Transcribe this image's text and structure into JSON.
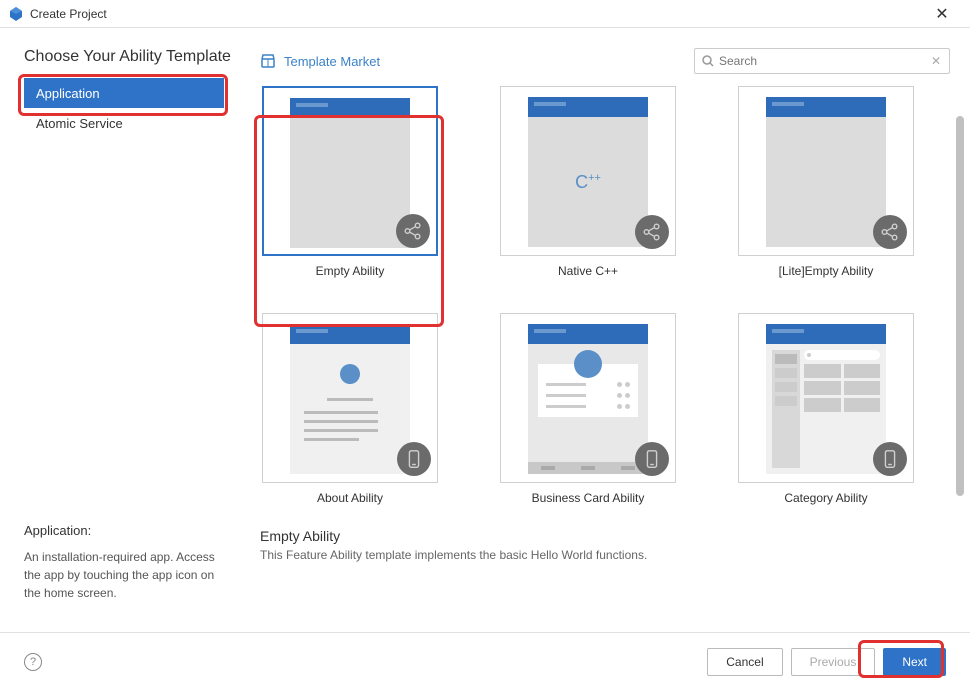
{
  "window": {
    "title": "Create Project"
  },
  "sidebar": {
    "heading": "Choose Your Ability Template",
    "items": [
      "Application",
      "Atomic Service"
    ],
    "selected_index": 0,
    "desc_title": "Application:",
    "desc_text": "An installation-required app. Access the app by touching the app icon on the home screen."
  },
  "main": {
    "market_label": "Template Market",
    "search_placeholder": "Search",
    "templates": [
      {
        "name": "Empty Ability",
        "selected": true,
        "icon": "share",
        "content": "blank"
      },
      {
        "name": "Native C++",
        "selected": false,
        "icon": "share",
        "content": "cpp"
      },
      {
        "name": "[Lite]Empty Ability",
        "selected": false,
        "icon": "share",
        "content": "blank"
      },
      {
        "name": "About Ability",
        "selected": false,
        "icon": "phone",
        "content": "about"
      },
      {
        "name": "Business Card Ability",
        "selected": false,
        "icon": "phone",
        "content": "bizcard"
      },
      {
        "name": "Category Ability",
        "selected": false,
        "icon": "phone",
        "content": "category"
      }
    ],
    "selected_template": {
      "title": "Empty Ability",
      "description": "This Feature Ability template implements the basic Hello World functions."
    }
  },
  "footer": {
    "cancel": "Cancel",
    "previous": "Previous",
    "next": "Next",
    "previous_enabled": false
  },
  "icons": {
    "app_logo": "deveco-logo",
    "close": "✕",
    "search": "search-icon",
    "clear": "✕",
    "market": "market-icon",
    "help": "?"
  }
}
